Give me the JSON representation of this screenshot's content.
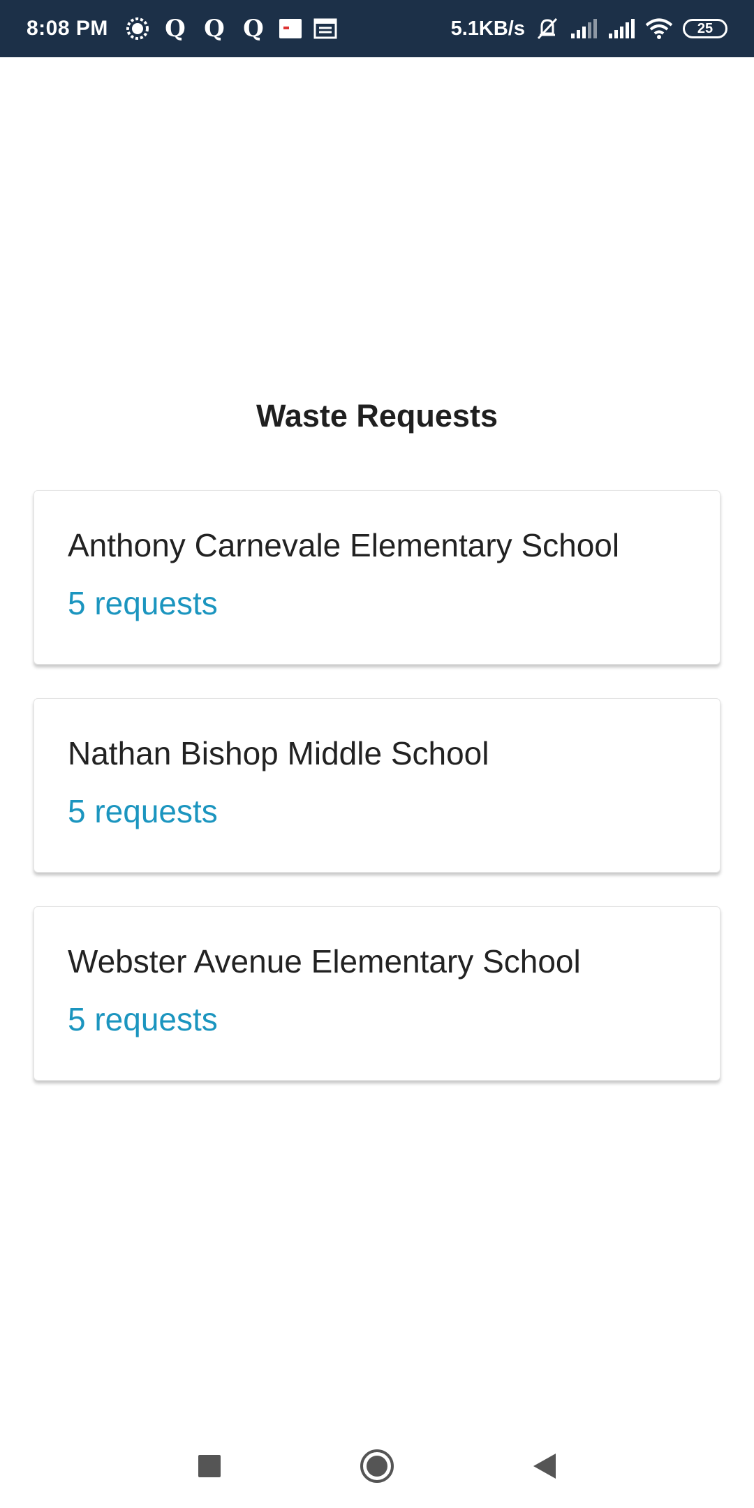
{
  "status_bar": {
    "time": "8:08 PM",
    "q_icons": [
      "Q",
      "Q",
      "Q"
    ],
    "net_speed": "5.1KB/s",
    "battery": "25"
  },
  "page": {
    "title": "Waste Requests"
  },
  "schools": [
    {
      "name": "Anthony Carnevale Elementary School",
      "count": "5 requests"
    },
    {
      "name": "Nathan Bishop Middle School",
      "count": "5 requests"
    },
    {
      "name": "Webster Avenue Elementary School",
      "count": "5 requests"
    }
  ],
  "colors": {
    "status_bar_bg": "#1c3048",
    "accent": "#1b95bf",
    "text": "#222222"
  },
  "icons": {
    "nav": [
      "recents-square-icon",
      "home-circle-icon",
      "back-triangle-icon"
    ]
  }
}
